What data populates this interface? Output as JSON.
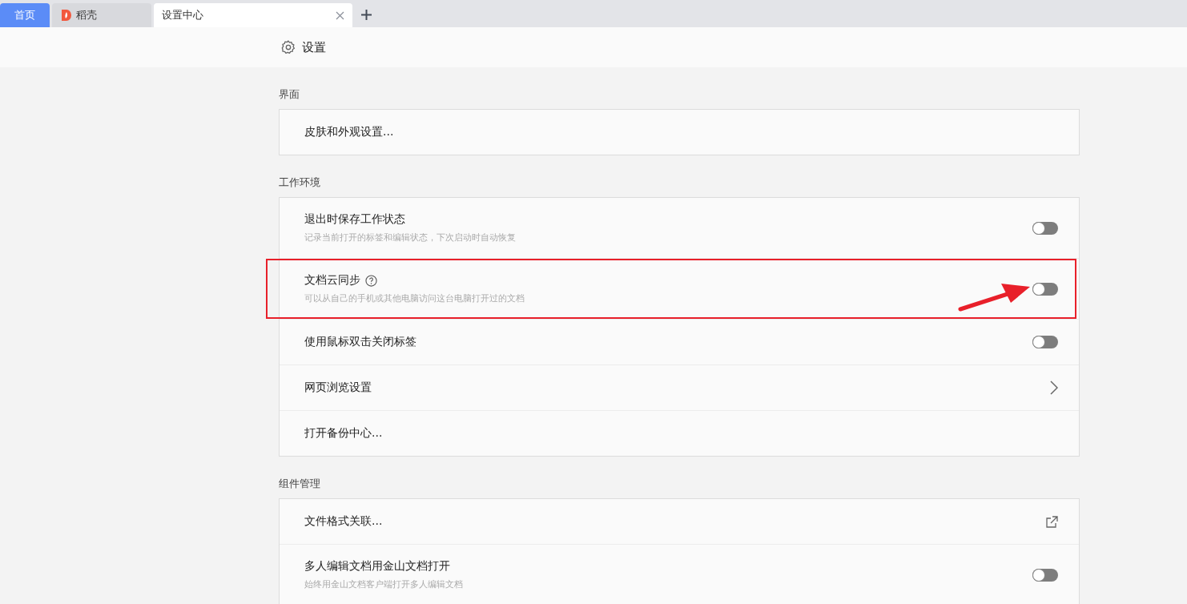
{
  "tabs": [
    {
      "label": "首页",
      "kind": "home",
      "selected": false
    },
    {
      "label": "稻壳",
      "kind": "app",
      "selected": false
    },
    {
      "label": "设置中心",
      "kind": "page",
      "selected": true
    }
  ],
  "header": {
    "title": "设置"
  },
  "sections": [
    {
      "title": "界面",
      "rows": [
        {
          "kind": "plain",
          "title": "皮肤和外观设置..."
        }
      ]
    },
    {
      "title": "工作环境",
      "rows": [
        {
          "kind": "toggle",
          "title": "退出时保存工作状态",
          "description": "记录当前打开的标签和编辑状态，下次启动时自动恢复",
          "on": false
        },
        {
          "kind": "toggle",
          "title": "文档云同步",
          "help": true,
          "description": "可以从自己的手机或其他电脑访问这台电脑打开过的文档",
          "on": false,
          "highlighted": true
        },
        {
          "kind": "toggle",
          "title": "使用鼠标双击关闭标签",
          "on": false
        },
        {
          "kind": "chevron",
          "title": "网页浏览设置"
        },
        {
          "kind": "plain",
          "title": "打开备份中心..."
        }
      ]
    },
    {
      "title": "组件管理",
      "rows": [
        {
          "kind": "external",
          "title": "文件格式关联..."
        },
        {
          "kind": "toggle",
          "title": "多人编辑文档用金山文档打开",
          "description": "始终用金山文档客户端打开多人编辑文档",
          "on": false
        }
      ]
    }
  ]
}
